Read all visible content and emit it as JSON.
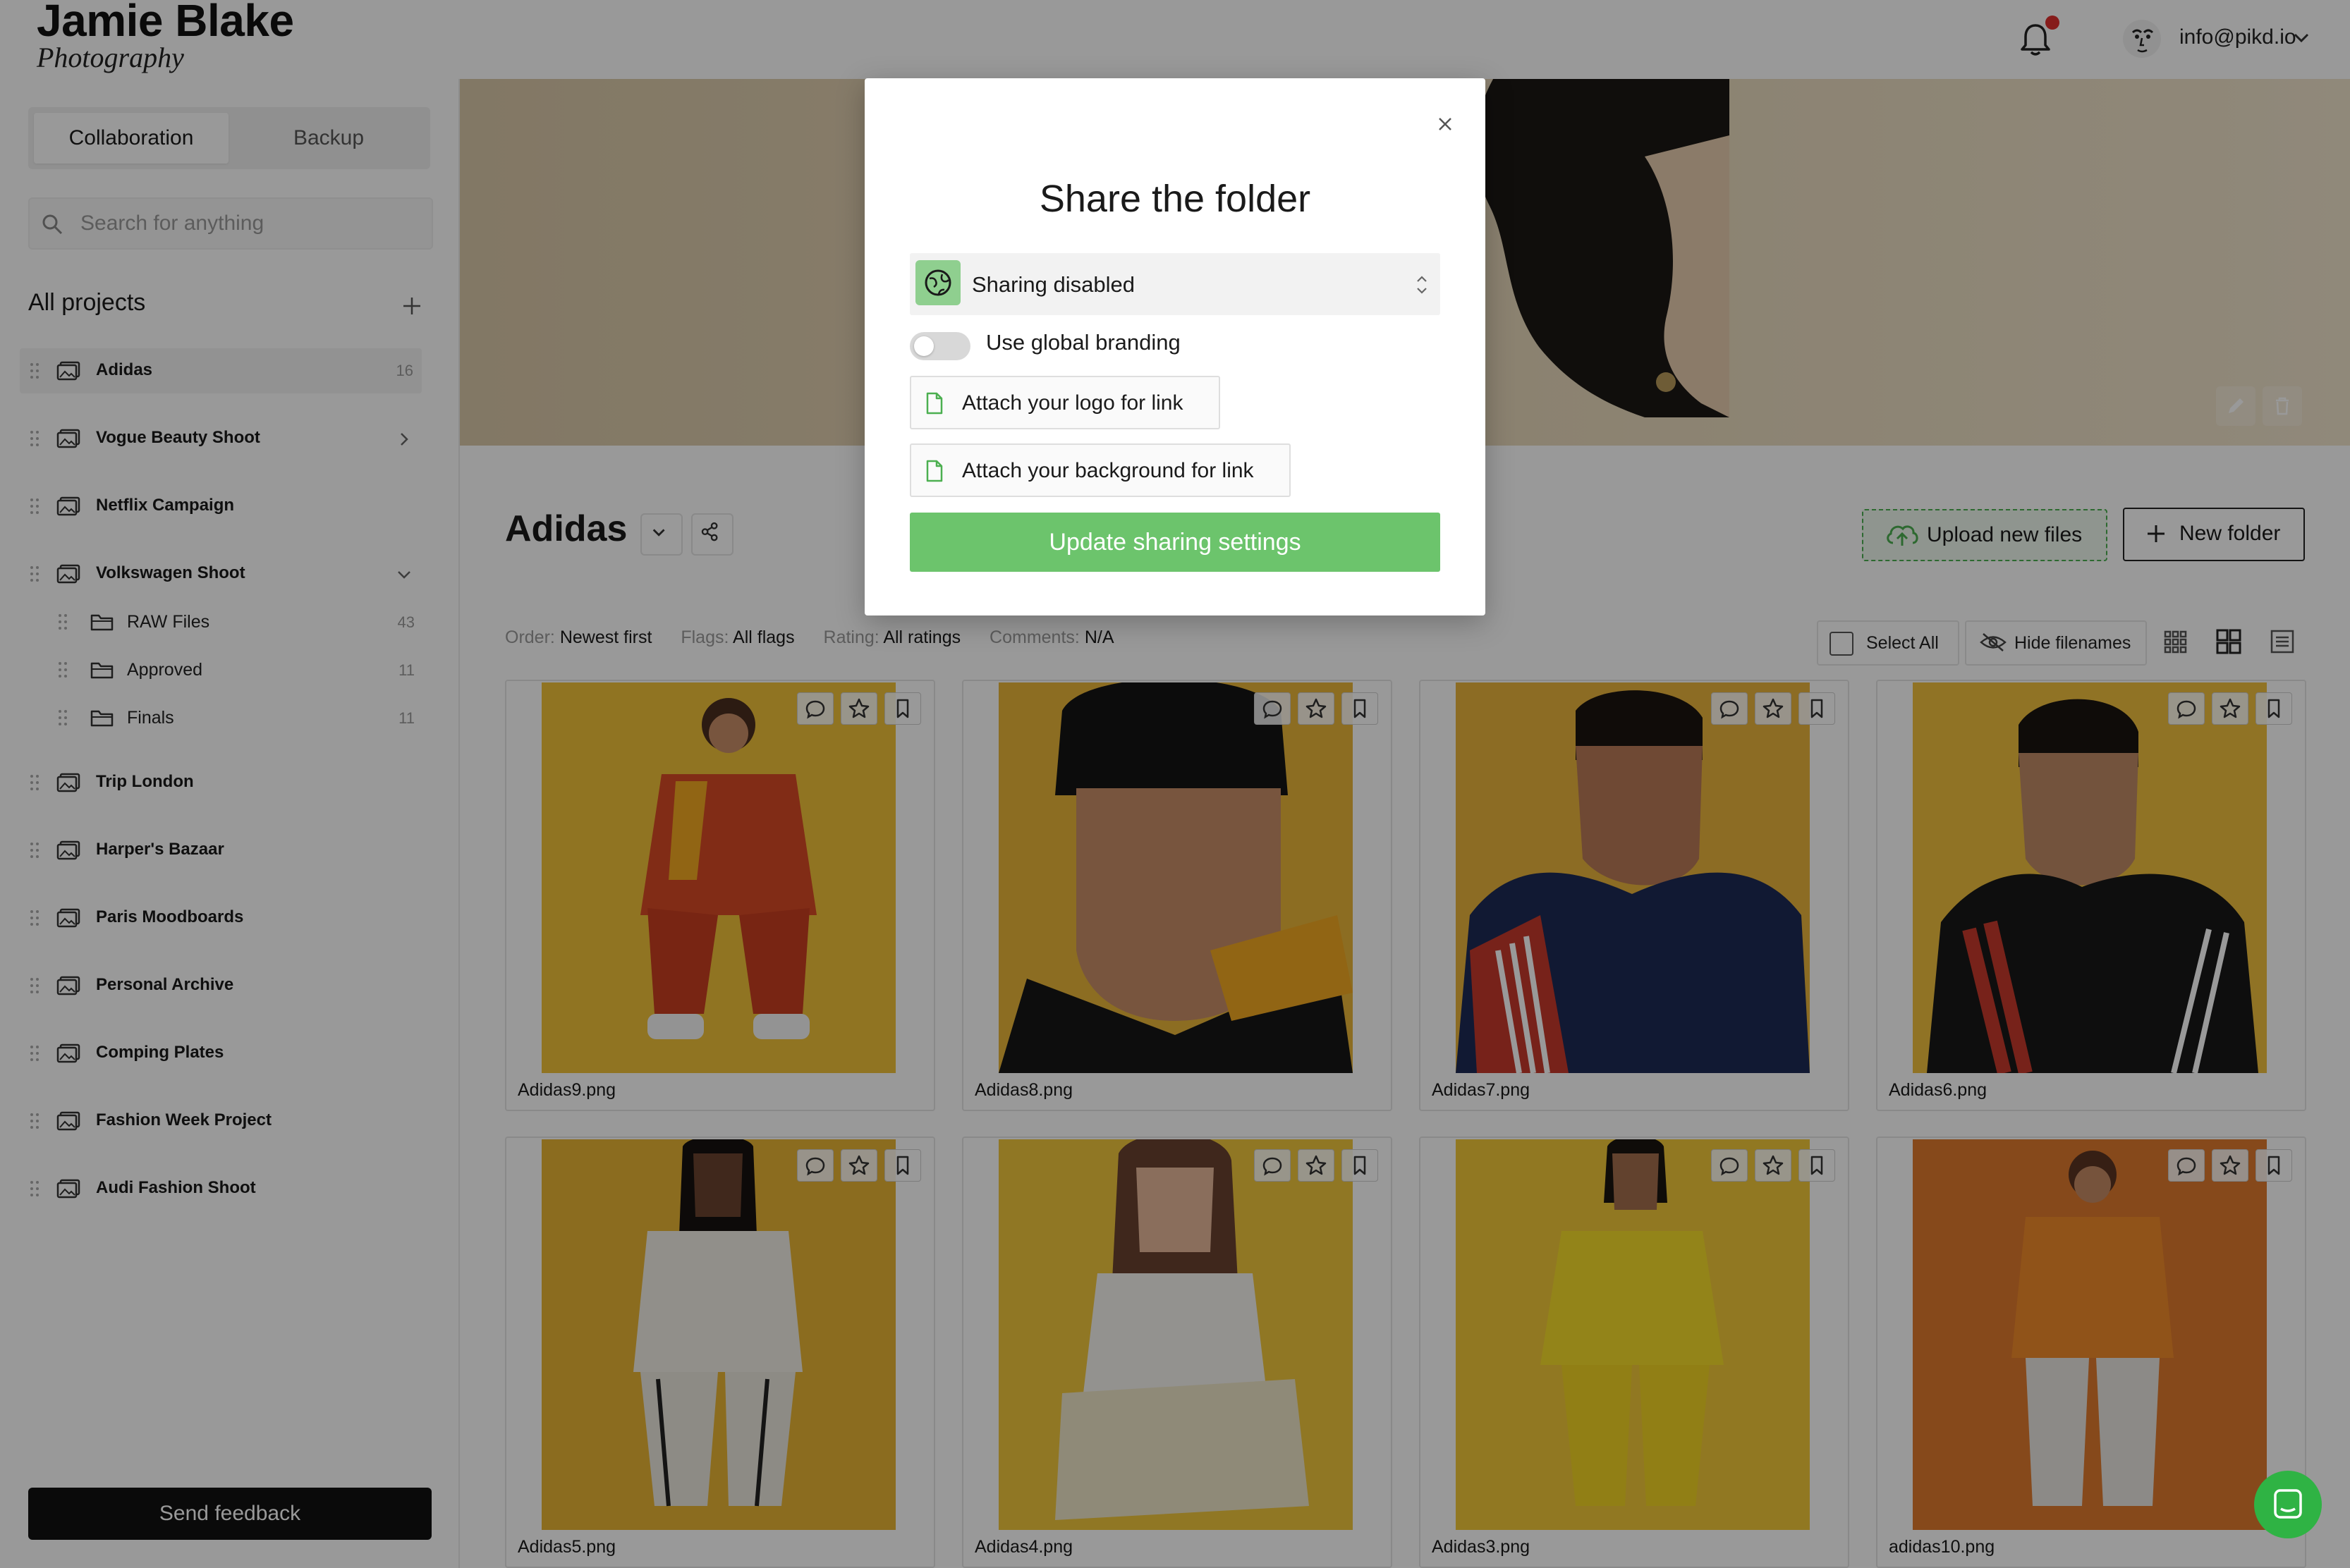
{
  "brand": {
    "name": "Jamie Blake",
    "tagline": "Photography"
  },
  "topbar": {
    "user_email": "info@pikd.io",
    "has_notification": true
  },
  "sidebar": {
    "tabs": [
      {
        "label": "Collaboration",
        "active": true
      },
      {
        "label": "Backup",
        "active": false
      }
    ],
    "search_placeholder": "Search for anything",
    "projects_heading": "All projects",
    "projects": [
      {
        "label": "Adidas",
        "count": "16",
        "active": true
      },
      {
        "label": "Vogue Beauty Shoot",
        "expandable": true,
        "expanded": false
      },
      {
        "label": "Netflix Campaign"
      },
      {
        "label": "Volkswagen Shoot",
        "expandable": true,
        "expanded": true,
        "children": [
          {
            "label": "RAW Files",
            "count": "43"
          },
          {
            "label": "Approved",
            "count": "11"
          },
          {
            "label": "Finals",
            "count": "11"
          }
        ]
      },
      {
        "label": "Trip London"
      },
      {
        "label": "Harper's Bazaar"
      },
      {
        "label": "Paris Moodboards"
      },
      {
        "label": "Personal Archive"
      },
      {
        "label": "Comping Plates"
      },
      {
        "label": "Fashion Week Project"
      },
      {
        "label": "Audi Fashion Shoot"
      }
    ],
    "feedback_label": "Send feedback"
  },
  "main": {
    "folder_title": "Adidas",
    "upload_label": "Upload new files",
    "new_folder_label": "New folder",
    "filters": {
      "order_key": "Order:",
      "order_value": "Newest first",
      "flags_key": "Flags:",
      "flags_value": "All flags",
      "rating_key": "Rating:",
      "rating_value": "All ratings",
      "comments_key": "Comments:",
      "comments_value": "N/A"
    },
    "select_all_label": "Select All",
    "hide_filenames_label": "Hide filenames",
    "images": [
      {
        "name": "Adidas9.png",
        "bg": "#f0c23a"
      },
      {
        "name": "Adidas8.png",
        "bg": "#eab63a"
      },
      {
        "name": "Adidas7.png",
        "bg": "#e9b43c"
      },
      {
        "name": "Adidas6.png",
        "bg": "#f0c03e"
      },
      {
        "name": "Adidas5.png",
        "bg": "#e8b534"
      },
      {
        "name": "Adidas4.png",
        "bg": "#f0c63c"
      },
      {
        "name": "Adidas3.png",
        "bg": "#f2c83a"
      },
      {
        "name": "adidas10.png",
        "bg": "#e07a2e"
      }
    ]
  },
  "modal": {
    "title": "Share the folder",
    "sharing_status": "Sharing disabled",
    "branding_toggle_label": "Use global branding",
    "branding_enabled": false,
    "attach_logo_label": "Attach your logo for link",
    "attach_background_label": "Attach your background for link",
    "update_label": "Update sharing settings"
  },
  "colors": {
    "accent_green": "#6cc46c",
    "notification_red": "#e0302e"
  }
}
